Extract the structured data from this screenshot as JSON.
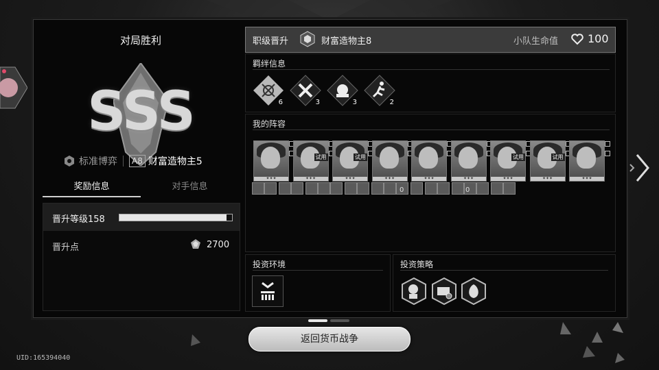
{
  "left": {
    "result_title": "对局胜利",
    "rank": "SSS",
    "mode": "标准博弈",
    "ascension_badge": "A8",
    "difficulty": "财富造物主5",
    "tabs": [
      {
        "label": "奖励信息",
        "active": true
      },
      {
        "label": "对手信息",
        "active": false
      }
    ],
    "level_label": "晋升等级158",
    "level_progress": 0.95,
    "points_label": "晋升点",
    "points_value": "2700"
  },
  "header": {
    "label": "职级晋升",
    "difficulty": "财富造物主8",
    "hp_label": "小队生命值",
    "hp_value": "100"
  },
  "bonds": {
    "title": "羁绊信息",
    "items": [
      {
        "icon": "bond-atom-icon",
        "count": "6"
      },
      {
        "icon": "bond-tools-icon",
        "count": "3"
      },
      {
        "icon": "bond-crest-icon",
        "count": "3"
      },
      {
        "icon": "bond-runner-icon",
        "count": "2"
      }
    ]
  },
  "lineup": {
    "title": "我的阵容",
    "trial_label": "试用",
    "characters": [
      {
        "trial": false
      },
      {
        "trial": true
      },
      {
        "trial": true
      },
      {
        "trial": false
      },
      {
        "trial": false
      },
      {
        "trial": false
      },
      {
        "trial": true
      },
      {
        "trial": true
      },
      {
        "trial": false
      }
    ],
    "relic_counts": [
      "0",
      "0"
    ]
  },
  "environment": {
    "title": "投资环境",
    "icon": "investment-building-icon"
  },
  "strategy": {
    "title": "投资策略",
    "icons": [
      "strategy-figure-icon",
      "strategy-chest-icon",
      "strategy-bag-icon"
    ]
  },
  "return_button": "返回货币战争",
  "uid": "UID:165394040",
  "colors": {
    "panel": "#070707",
    "header": "#3b3b3b",
    "button": "#d8d8d8"
  }
}
